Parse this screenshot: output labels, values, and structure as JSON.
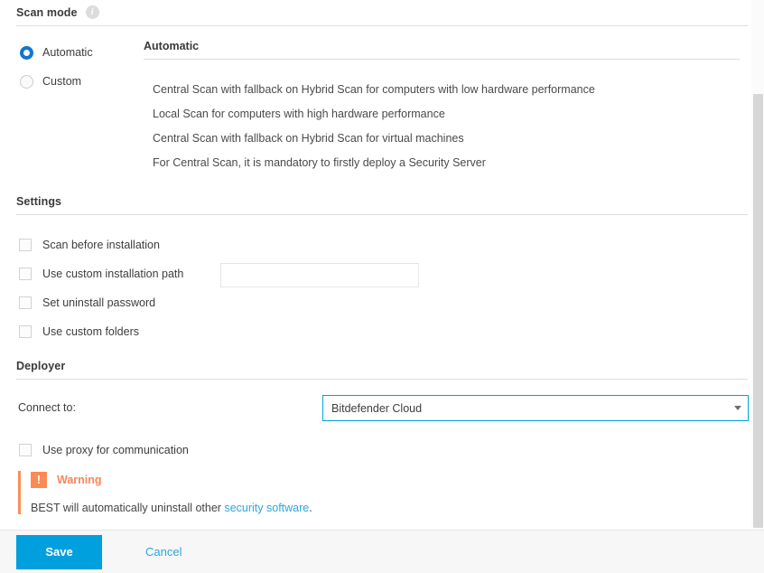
{
  "scan_mode": {
    "title": "Scan mode",
    "info_icon": "info-icon",
    "options": [
      {
        "label": "Automatic",
        "selected": true
      },
      {
        "label": "Custom",
        "selected": false
      }
    ],
    "detail": {
      "title": "Automatic",
      "items": [
        "Central Scan with fallback on Hybrid Scan for computers with low hardware performance",
        "Local Scan for computers with high hardware performance",
        "Central Scan with fallback on Hybrid Scan for virtual machines",
        "For Central Scan, it is mandatory to firstly deploy a Security Server"
      ]
    }
  },
  "settings": {
    "title": "Settings",
    "checkboxes": [
      {
        "label": "Scan before installation",
        "checked": false
      },
      {
        "label": "Use custom installation path",
        "checked": false
      },
      {
        "label": "Set uninstall password",
        "checked": false
      },
      {
        "label": "Use custom folders",
        "checked": false
      }
    ],
    "custom_path": {
      "value": "",
      "placeholder": ""
    }
  },
  "deployer": {
    "title": "Deployer",
    "connect_label": "Connect to:",
    "connect_value": "Bitdefender Cloud",
    "proxy_checkbox": {
      "label": "Use proxy for communication",
      "checked": false
    }
  },
  "warning": {
    "icon": "exclamation-icon",
    "title": "Warning",
    "text_before": "BEST will automatically uninstall other ",
    "link": "security software",
    "text_after": "."
  },
  "footer": {
    "save_label": "Save",
    "cancel_label": "Cancel"
  },
  "colors": {
    "accent_blue": "#00a0df",
    "radio_blue": "#1275d1",
    "link_blue": "#2ba6e0",
    "warning_orange": "#fa8b55",
    "divider": "#dcdcdc"
  }
}
